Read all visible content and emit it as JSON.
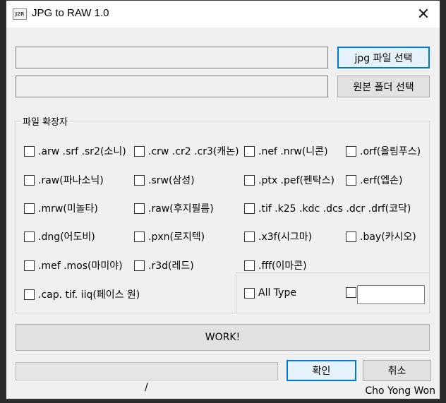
{
  "window": {
    "icon_text": "J2R",
    "title": "JPG to RAW 1.0",
    "close_glyph": "✕"
  },
  "inputs": {
    "jpg_path": "",
    "folder_path": ""
  },
  "buttons": {
    "select_jpg": "jpg 파일 선택",
    "select_folder": "원본 폴더 선택",
    "work": "WORK!",
    "ok": "확인",
    "cancel": "취소"
  },
  "group": {
    "title": "파일 확장자",
    "extensions": [
      ".arw .srf .sr2(소니)",
      ".crw .cr2 .cr3(캐논)",
      ".nef .nrw(니콘)",
      ".orf(올림푸스)",
      ".raw(파나소닉)",
      ".srw(삼성)",
      ".ptx .pef(펜탁스)",
      ".erf(엡손)",
      ".mrw(미놀타)",
      ".raw(후지필름)",
      ".tif .k25 .kdc .dcs .dcr .drf(코닥)",
      ".dng(어도비)",
      ".pxn(로지텍)",
      ".x3f(시그마)",
      ".bay(카시오)",
      ".mef .mos(마미야)",
      ".r3d(레드)",
      ".fff(이마콘)",
      ".cap. tif. iiq(페이스 원)",
      "All Type"
    ],
    "custom_type_value": ""
  },
  "status": {
    "progress": 0,
    "counter_text": "/",
    "author": "Cho Yong Won"
  }
}
